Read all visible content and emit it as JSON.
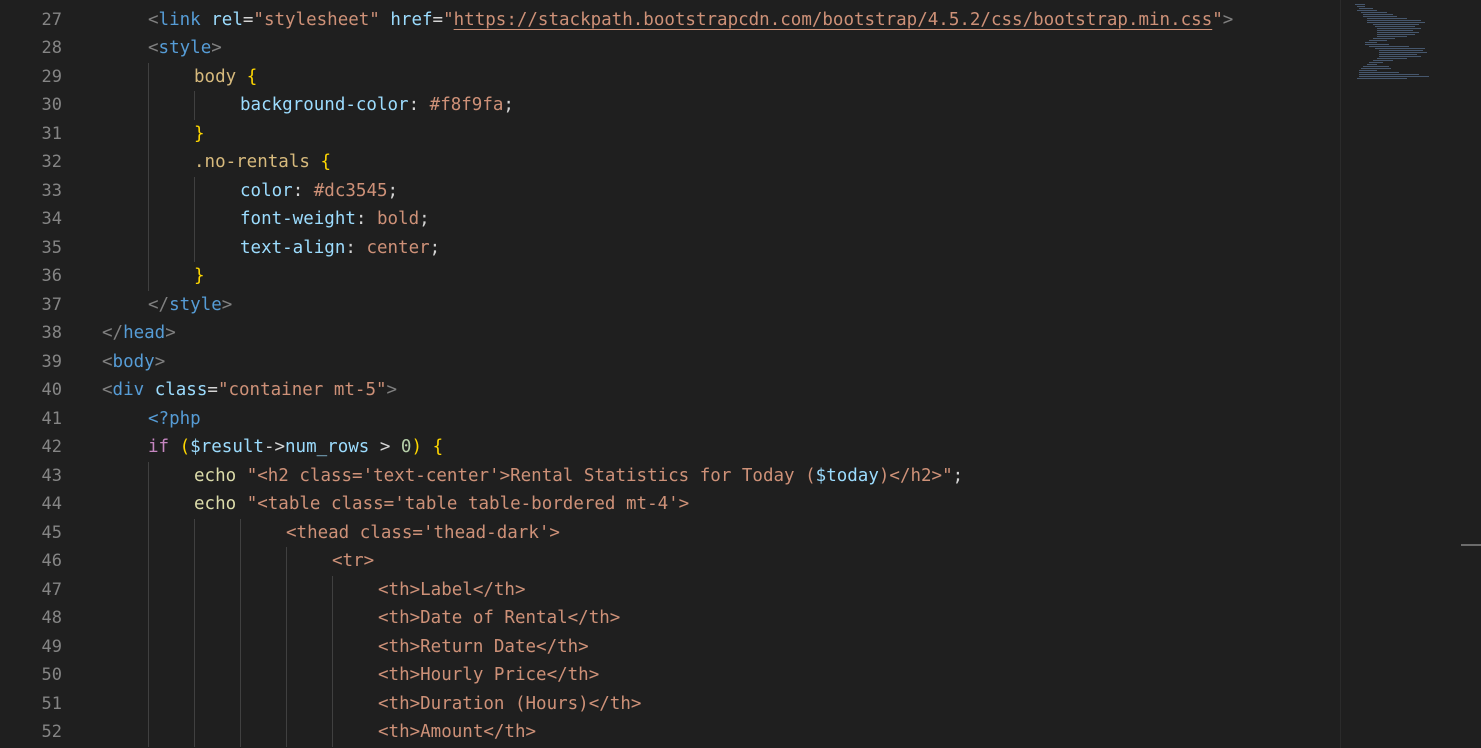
{
  "editor": {
    "lines": [
      {
        "n": "27",
        "indent": 1,
        "tokens": [
          {
            "t": "<",
            "c": "punct"
          },
          {
            "t": "link",
            "c": "tag"
          },
          {
            "t": " ",
            "c": "pl"
          },
          {
            "t": "rel",
            "c": "attr"
          },
          {
            "t": "=",
            "c": "op"
          },
          {
            "t": "\"stylesheet\"",
            "c": "str"
          },
          {
            "t": " ",
            "c": "pl"
          },
          {
            "t": "href",
            "c": "attr"
          },
          {
            "t": "=",
            "c": "op"
          },
          {
            "t": "\"",
            "c": "str"
          },
          {
            "t": "https://stackpath.bootstrapcdn.com/bootstrap/4.5.2/css/bootstrap.min.css",
            "c": "link"
          },
          {
            "t": "\"",
            "c": "str"
          },
          {
            "t": ">",
            "c": "punct"
          }
        ]
      },
      {
        "n": "28",
        "indent": 1,
        "tokens": [
          {
            "t": "<",
            "c": "punct"
          },
          {
            "t": "style",
            "c": "tag"
          },
          {
            "t": ">",
            "c": "punct"
          }
        ]
      },
      {
        "n": "29",
        "indent": 2,
        "tokens": [
          {
            "t": "body",
            "c": "sel"
          },
          {
            "t": " ",
            "c": "pl"
          },
          {
            "t": "{",
            "c": "yellow"
          }
        ]
      },
      {
        "n": "30",
        "indent": 3,
        "tokens": [
          {
            "t": "background-color",
            "c": "prop"
          },
          {
            "t": ": ",
            "c": "op"
          },
          {
            "t": "#f8f9fa",
            "c": "str"
          },
          {
            "t": ";",
            "c": "op"
          }
        ]
      },
      {
        "n": "31",
        "indent": 2,
        "tokens": [
          {
            "t": "}",
            "c": "yellow"
          }
        ]
      },
      {
        "n": "32",
        "indent": 2,
        "tokens": [
          {
            "t": ".no-rentals",
            "c": "sel"
          },
          {
            "t": " ",
            "c": "pl"
          },
          {
            "t": "{",
            "c": "yellow"
          }
        ]
      },
      {
        "n": "33",
        "indent": 3,
        "tokens": [
          {
            "t": "color",
            "c": "prop"
          },
          {
            "t": ": ",
            "c": "op"
          },
          {
            "t": "#dc3545",
            "c": "str"
          },
          {
            "t": ";",
            "c": "op"
          }
        ]
      },
      {
        "n": "34",
        "indent": 3,
        "tokens": [
          {
            "t": "font-weight",
            "c": "prop"
          },
          {
            "t": ": ",
            "c": "op"
          },
          {
            "t": "bold",
            "c": "str"
          },
          {
            "t": ";",
            "c": "op"
          }
        ]
      },
      {
        "n": "35",
        "indent": 3,
        "tokens": [
          {
            "t": "text-align",
            "c": "prop"
          },
          {
            "t": ": ",
            "c": "op"
          },
          {
            "t": "center",
            "c": "str"
          },
          {
            "t": ";",
            "c": "op"
          }
        ]
      },
      {
        "n": "36",
        "indent": 2,
        "tokens": [
          {
            "t": "}",
            "c": "yellow"
          }
        ]
      },
      {
        "n": "37",
        "indent": 1,
        "tokens": [
          {
            "t": "</",
            "c": "punct"
          },
          {
            "t": "style",
            "c": "tag"
          },
          {
            "t": ">",
            "c": "punct"
          }
        ]
      },
      {
        "n": "38",
        "indent": 0,
        "tokens": [
          {
            "t": "</",
            "c": "punct"
          },
          {
            "t": "head",
            "c": "tag"
          },
          {
            "t": ">",
            "c": "punct"
          }
        ]
      },
      {
        "n": "39",
        "indent": 0,
        "tokens": [
          {
            "t": "<",
            "c": "punct"
          },
          {
            "t": "body",
            "c": "tag"
          },
          {
            "t": ">",
            "c": "punct"
          }
        ]
      },
      {
        "n": "40",
        "indent": 0,
        "tokens": [
          {
            "t": "<",
            "c": "punct"
          },
          {
            "t": "div",
            "c": "tag"
          },
          {
            "t": " ",
            "c": "pl"
          },
          {
            "t": "class",
            "c": "attr"
          },
          {
            "t": "=",
            "c": "op"
          },
          {
            "t": "\"container mt-5\"",
            "c": "str"
          },
          {
            "t": ">",
            "c": "punct"
          }
        ]
      },
      {
        "n": "41",
        "indent": 1,
        "tokens": [
          {
            "t": "<?php",
            "c": "tag"
          }
        ]
      },
      {
        "n": "42",
        "indent": 1,
        "tokens": [
          {
            "t": "if",
            "c": "kw"
          },
          {
            "t": " ",
            "c": "pl"
          },
          {
            "t": "(",
            "c": "yellow"
          },
          {
            "t": "$result",
            "c": "var"
          },
          {
            "t": "->",
            "c": "op"
          },
          {
            "t": "num_rows",
            "c": "var"
          },
          {
            "t": " > ",
            "c": "op"
          },
          {
            "t": "0",
            "c": "num"
          },
          {
            "t": ")",
            "c": "yellow"
          },
          {
            "t": " ",
            "c": "pl"
          },
          {
            "t": "{",
            "c": "yellow"
          }
        ]
      },
      {
        "n": "43",
        "indent": 2,
        "tokens": [
          {
            "t": "echo",
            "c": "fn"
          },
          {
            "t": " ",
            "c": "pl"
          },
          {
            "t": "\"<h2 class='text-center'>Rental Statistics for Today (",
            "c": "str"
          },
          {
            "t": "$today",
            "c": "var"
          },
          {
            "t": ")</h2>\"",
            "c": "str"
          },
          {
            "t": ";",
            "c": "op"
          }
        ]
      },
      {
        "n": "44",
        "indent": 2,
        "tokens": [
          {
            "t": "echo",
            "c": "fn"
          },
          {
            "t": " ",
            "c": "pl"
          },
          {
            "t": "\"<table class='table table-bordered mt-4'>",
            "c": "str"
          }
        ]
      },
      {
        "n": "45",
        "indent": 4,
        "tokens": [
          {
            "t": "<thead class='thead-dark'>",
            "c": "str"
          }
        ]
      },
      {
        "n": "46",
        "indent": 5,
        "tokens": [
          {
            "t": "<tr>",
            "c": "str"
          }
        ]
      },
      {
        "n": "47",
        "indent": 6,
        "tokens": [
          {
            "t": "<th>Label</th>",
            "c": "str"
          }
        ]
      },
      {
        "n": "48",
        "indent": 6,
        "tokens": [
          {
            "t": "<th>Date of Rental</th>",
            "c": "str"
          }
        ]
      },
      {
        "n": "49",
        "indent": 6,
        "tokens": [
          {
            "t": "<th>Return Date</th>",
            "c": "str"
          }
        ]
      },
      {
        "n": "50",
        "indent": 6,
        "tokens": [
          {
            "t": "<th>Hourly Price</th>",
            "c": "str"
          }
        ]
      },
      {
        "n": "51",
        "indent": 6,
        "tokens": [
          {
            "t": "<th>Duration (Hours)</th>",
            "c": "str"
          }
        ]
      },
      {
        "n": "52",
        "indent": 6,
        "tokens": [
          {
            "t": "<th>Amount</th>",
            "c": "str"
          }
        ]
      }
    ]
  },
  "colors": {
    "background": "#1f1f1f",
    "line_number": "#858585",
    "tag": "#569cd6",
    "attribute": "#9cdcfe",
    "string": "#ce9178",
    "bracket": "#ffd700",
    "selector": "#d7ba7d",
    "keyword": "#c586c0",
    "function": "#dcdcaa"
  }
}
